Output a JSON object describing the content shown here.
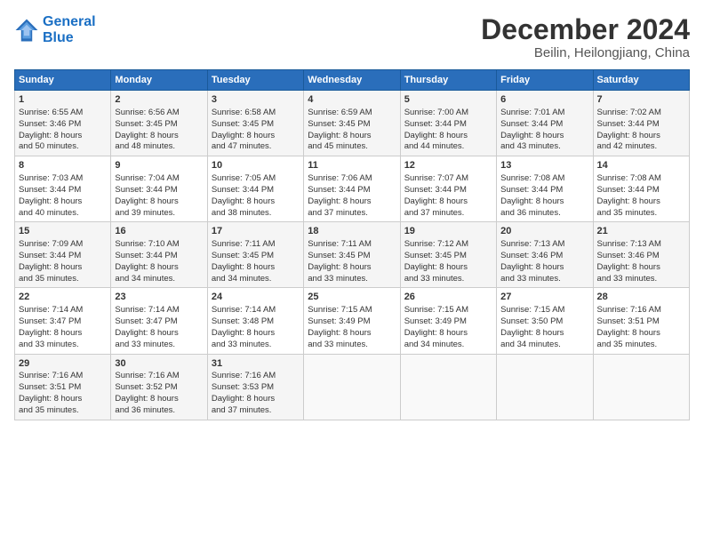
{
  "header": {
    "logo_line1": "General",
    "logo_line2": "Blue",
    "title": "December 2024",
    "subtitle": "Beilin, Heilongjiang, China"
  },
  "columns": [
    "Sunday",
    "Monday",
    "Tuesday",
    "Wednesday",
    "Thursday",
    "Friday",
    "Saturday"
  ],
  "weeks": [
    [
      {
        "day": "1",
        "lines": [
          "Sunrise: 6:55 AM",
          "Sunset: 3:46 PM",
          "Daylight: 8 hours",
          "and 50 minutes."
        ]
      },
      {
        "day": "2",
        "lines": [
          "Sunrise: 6:56 AM",
          "Sunset: 3:45 PM",
          "Daylight: 8 hours",
          "and 48 minutes."
        ]
      },
      {
        "day": "3",
        "lines": [
          "Sunrise: 6:58 AM",
          "Sunset: 3:45 PM",
          "Daylight: 8 hours",
          "and 47 minutes."
        ]
      },
      {
        "day": "4",
        "lines": [
          "Sunrise: 6:59 AM",
          "Sunset: 3:45 PM",
          "Daylight: 8 hours",
          "and 45 minutes."
        ]
      },
      {
        "day": "5",
        "lines": [
          "Sunrise: 7:00 AM",
          "Sunset: 3:44 PM",
          "Daylight: 8 hours",
          "and 44 minutes."
        ]
      },
      {
        "day": "6",
        "lines": [
          "Sunrise: 7:01 AM",
          "Sunset: 3:44 PM",
          "Daylight: 8 hours",
          "and 43 minutes."
        ]
      },
      {
        "day": "7",
        "lines": [
          "Sunrise: 7:02 AM",
          "Sunset: 3:44 PM",
          "Daylight: 8 hours",
          "and 42 minutes."
        ]
      }
    ],
    [
      {
        "day": "8",
        "lines": [
          "Sunrise: 7:03 AM",
          "Sunset: 3:44 PM",
          "Daylight: 8 hours",
          "and 40 minutes."
        ]
      },
      {
        "day": "9",
        "lines": [
          "Sunrise: 7:04 AM",
          "Sunset: 3:44 PM",
          "Daylight: 8 hours",
          "and 39 minutes."
        ]
      },
      {
        "day": "10",
        "lines": [
          "Sunrise: 7:05 AM",
          "Sunset: 3:44 PM",
          "Daylight: 8 hours",
          "and 38 minutes."
        ]
      },
      {
        "day": "11",
        "lines": [
          "Sunrise: 7:06 AM",
          "Sunset: 3:44 PM",
          "Daylight: 8 hours",
          "and 37 minutes."
        ]
      },
      {
        "day": "12",
        "lines": [
          "Sunrise: 7:07 AM",
          "Sunset: 3:44 PM",
          "Daylight: 8 hours",
          "and 37 minutes."
        ]
      },
      {
        "day": "13",
        "lines": [
          "Sunrise: 7:08 AM",
          "Sunset: 3:44 PM",
          "Daylight: 8 hours",
          "and 36 minutes."
        ]
      },
      {
        "day": "14",
        "lines": [
          "Sunrise: 7:08 AM",
          "Sunset: 3:44 PM",
          "Daylight: 8 hours",
          "and 35 minutes."
        ]
      }
    ],
    [
      {
        "day": "15",
        "lines": [
          "Sunrise: 7:09 AM",
          "Sunset: 3:44 PM",
          "Daylight: 8 hours",
          "and 35 minutes."
        ]
      },
      {
        "day": "16",
        "lines": [
          "Sunrise: 7:10 AM",
          "Sunset: 3:44 PM",
          "Daylight: 8 hours",
          "and 34 minutes."
        ]
      },
      {
        "day": "17",
        "lines": [
          "Sunrise: 7:11 AM",
          "Sunset: 3:45 PM",
          "Daylight: 8 hours",
          "and 34 minutes."
        ]
      },
      {
        "day": "18",
        "lines": [
          "Sunrise: 7:11 AM",
          "Sunset: 3:45 PM",
          "Daylight: 8 hours",
          "and 33 minutes."
        ]
      },
      {
        "day": "19",
        "lines": [
          "Sunrise: 7:12 AM",
          "Sunset: 3:45 PM",
          "Daylight: 8 hours",
          "and 33 minutes."
        ]
      },
      {
        "day": "20",
        "lines": [
          "Sunrise: 7:13 AM",
          "Sunset: 3:46 PM",
          "Daylight: 8 hours",
          "and 33 minutes."
        ]
      },
      {
        "day": "21",
        "lines": [
          "Sunrise: 7:13 AM",
          "Sunset: 3:46 PM",
          "Daylight: 8 hours",
          "and 33 minutes."
        ]
      }
    ],
    [
      {
        "day": "22",
        "lines": [
          "Sunrise: 7:14 AM",
          "Sunset: 3:47 PM",
          "Daylight: 8 hours",
          "and 33 minutes."
        ]
      },
      {
        "day": "23",
        "lines": [
          "Sunrise: 7:14 AM",
          "Sunset: 3:47 PM",
          "Daylight: 8 hours",
          "and 33 minutes."
        ]
      },
      {
        "day": "24",
        "lines": [
          "Sunrise: 7:14 AM",
          "Sunset: 3:48 PM",
          "Daylight: 8 hours",
          "and 33 minutes."
        ]
      },
      {
        "day": "25",
        "lines": [
          "Sunrise: 7:15 AM",
          "Sunset: 3:49 PM",
          "Daylight: 8 hours",
          "and 33 minutes."
        ]
      },
      {
        "day": "26",
        "lines": [
          "Sunrise: 7:15 AM",
          "Sunset: 3:49 PM",
          "Daylight: 8 hours",
          "and 34 minutes."
        ]
      },
      {
        "day": "27",
        "lines": [
          "Sunrise: 7:15 AM",
          "Sunset: 3:50 PM",
          "Daylight: 8 hours",
          "and 34 minutes."
        ]
      },
      {
        "day": "28",
        "lines": [
          "Sunrise: 7:16 AM",
          "Sunset: 3:51 PM",
          "Daylight: 8 hours",
          "and 35 minutes."
        ]
      }
    ],
    [
      {
        "day": "29",
        "lines": [
          "Sunrise: 7:16 AM",
          "Sunset: 3:51 PM",
          "Daylight: 8 hours",
          "and 35 minutes."
        ]
      },
      {
        "day": "30",
        "lines": [
          "Sunrise: 7:16 AM",
          "Sunset: 3:52 PM",
          "Daylight: 8 hours",
          "and 36 minutes."
        ]
      },
      {
        "day": "31",
        "lines": [
          "Sunrise: 7:16 AM",
          "Sunset: 3:53 PM",
          "Daylight: 8 hours",
          "and 37 minutes."
        ]
      },
      {
        "day": "",
        "lines": []
      },
      {
        "day": "",
        "lines": []
      },
      {
        "day": "",
        "lines": []
      },
      {
        "day": "",
        "lines": []
      }
    ]
  ]
}
